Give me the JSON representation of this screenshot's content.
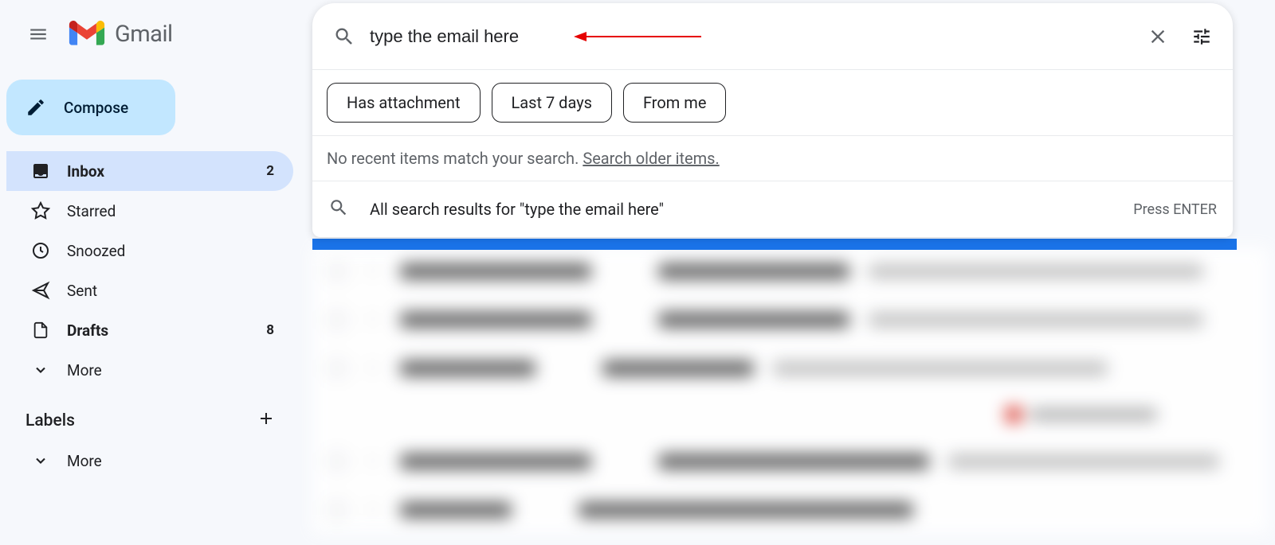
{
  "header": {
    "app_name": "Gmail"
  },
  "compose": {
    "label": "Compose"
  },
  "nav": {
    "inbox": {
      "label": "Inbox",
      "count": "2"
    },
    "starred": {
      "label": "Starred"
    },
    "snoozed": {
      "label": "Snoozed"
    },
    "sent": {
      "label": "Sent"
    },
    "drafts": {
      "label": "Drafts",
      "count": "8"
    },
    "more": {
      "label": "More"
    }
  },
  "labels_section": {
    "title": "Labels",
    "more": "More"
  },
  "search": {
    "input_value": "type the email here",
    "chips": {
      "has_attachment": "Has attachment",
      "last_7_days": "Last 7 days",
      "from_me": "From me"
    },
    "no_results_prefix": "No recent items match your search. ",
    "older_link": "Search older items.",
    "all_results_text": "All search results for \"type the email here\"",
    "press_enter": "Press ENTER"
  }
}
